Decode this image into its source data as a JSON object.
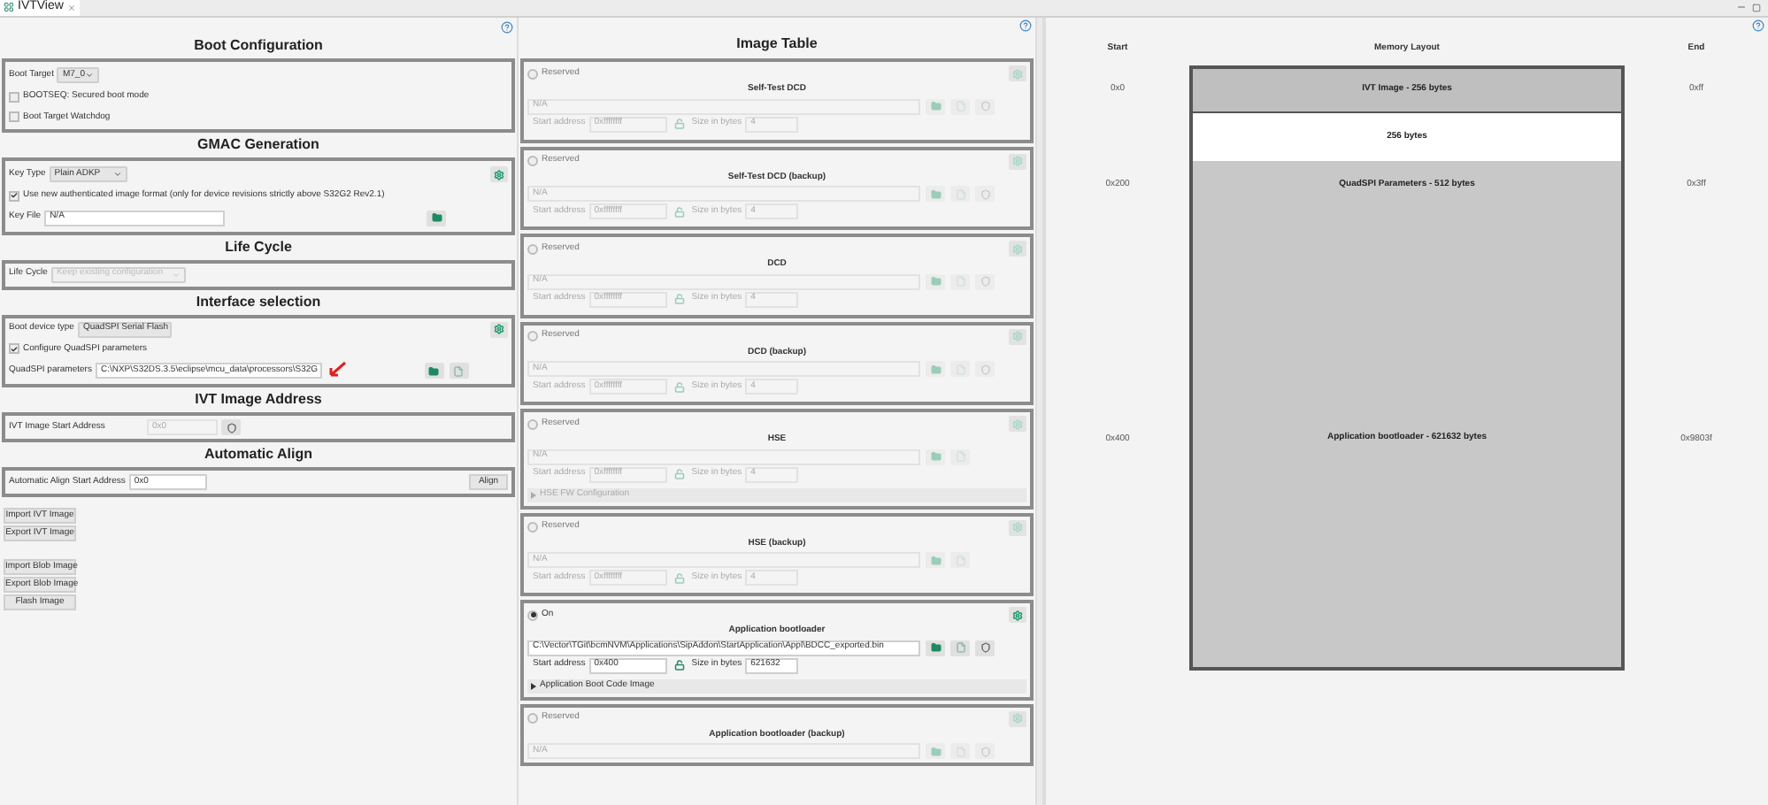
{
  "view_tab": {
    "title": "IVTView",
    "selected": true
  },
  "boot_configuration": {
    "title": "Boot Configuration",
    "boot_target": {
      "label": "Boot Target",
      "value": "M7_0"
    },
    "checkboxes": [
      {
        "label": "BOOTSEQ: Secured boot mode",
        "checked": false
      },
      {
        "label": "Boot Target Watchdog",
        "checked": false
      }
    ]
  },
  "gmac_generation": {
    "title": "GMAC Generation",
    "key_type": {
      "label": "Key Type",
      "value": "Plain ADKP"
    },
    "checkbox": {
      "label": "Use new authenticated image format (only for device revisions strictly above S32G2 Rev2.1)",
      "checked": true
    },
    "key_file": {
      "label": "Key File",
      "value": "N/A"
    }
  },
  "life_cycle": {
    "title": "Life Cycle",
    "label": "Life Cycle",
    "value": "Keep existing configuration",
    "disabled": true
  },
  "interface_selection": {
    "title": "Interface selection",
    "boot_device_type": {
      "label": "Boot device type",
      "value": "QuadSPI Serial Flash"
    },
    "checkbox": {
      "label": "Configure QuadSPI parameters",
      "checked": true
    },
    "quadspi_parameters": {
      "label": "QuadSPI parameters",
      "value": "C:\\NXP\\S32DS.3.5\\eclipse\\mcu_data\\processors\\S32G"
    }
  },
  "ivt_image_address": {
    "title": "IVT Image Address",
    "label": "IVT Image Start Address",
    "value": "0x0",
    "disabled": true
  },
  "automatic_align": {
    "title": "Automatic Align",
    "label": "Automatic Align Start Address",
    "value": "0x0",
    "button": "Align"
  },
  "action_buttons": [
    [
      "Import IVT Image",
      "Export IVT Image"
    ],
    [
      "Import Blob Image",
      "Export Blob Image",
      "Flash Image"
    ]
  ],
  "image_table": {
    "title": "Image Table",
    "entries": [
      {
        "status": "Reserved",
        "selected": false,
        "name": "Self-Test DCD",
        "path": "N/A",
        "start_label": "Start address",
        "start_address": "0xffffffff",
        "size_label": "Size in bytes",
        "size": "4",
        "shield": true
      },
      {
        "status": "Reserved",
        "selected": false,
        "name": "Self-Test DCD (backup)",
        "path": "N/A",
        "start_label": "Start address",
        "start_address": "0xffffffff",
        "size_label": "Size in bytes",
        "size": "4",
        "shield": true
      },
      {
        "status": "Reserved",
        "selected": false,
        "name": "DCD",
        "path": "N/A",
        "start_label": "Start address",
        "start_address": "0xffffffff",
        "size_label": "Size in bytes",
        "size": "4",
        "shield": true
      },
      {
        "status": "Reserved",
        "selected": false,
        "name": "DCD (backup)",
        "path": "N/A",
        "start_label": "Start address",
        "start_address": "0xffffffff",
        "size_label": "Size in bytes",
        "size": "4",
        "shield": true
      },
      {
        "status": "Reserved",
        "selected": false,
        "name": "HSE",
        "path": "N/A",
        "start_label": "Start address",
        "start_address": "0xffffffff",
        "size_label": "Size in bytes",
        "size": "4",
        "shield": false,
        "subsection": "HSE FW Configuration"
      },
      {
        "status": "Reserved",
        "selected": false,
        "name": "HSE (backup)",
        "path": "N/A",
        "start_label": "Start address",
        "start_address": "0xffffffff",
        "size_label": "Size in bytes",
        "size": "4",
        "shield": false
      },
      {
        "status": "On",
        "selected": true,
        "name": "Application bootloader",
        "path": "C:\\Vector\\TGit\\bcmNVM\\Applications\\SipAddon\\StartApplication\\Appl\\BDCC_exported.bin",
        "start_label": "Start address",
        "start_address": "0x400",
        "size_label": "Size in bytes",
        "size": "621632",
        "shield": true,
        "subsection": "Application Boot Code Image"
      },
      {
        "status": "Reserved",
        "selected": false,
        "name": "Application bootloader (backup)",
        "path": "N/A",
        "shield": true
      }
    ]
  },
  "memory_layout": {
    "start_header": "Start",
    "title": "Memory Layout",
    "end_header": "End",
    "blocks": [
      {
        "label": "IVT Image - 256 bytes",
        "start": "0x0",
        "end": "0xff",
        "color": "#bfbfbf"
      },
      {
        "label": "256 bytes",
        "color": "#ffffff"
      },
      {
        "label": "QuadSPI Parameters - 512 bytes",
        "start": "0x200",
        "end": "0x3ff",
        "color": "#c8c8c8"
      },
      {
        "label": "Application bootloader - 621632 bytes",
        "start": "0x400",
        "end": "0x9803f",
        "color": "#c8c8c8"
      }
    ]
  }
}
